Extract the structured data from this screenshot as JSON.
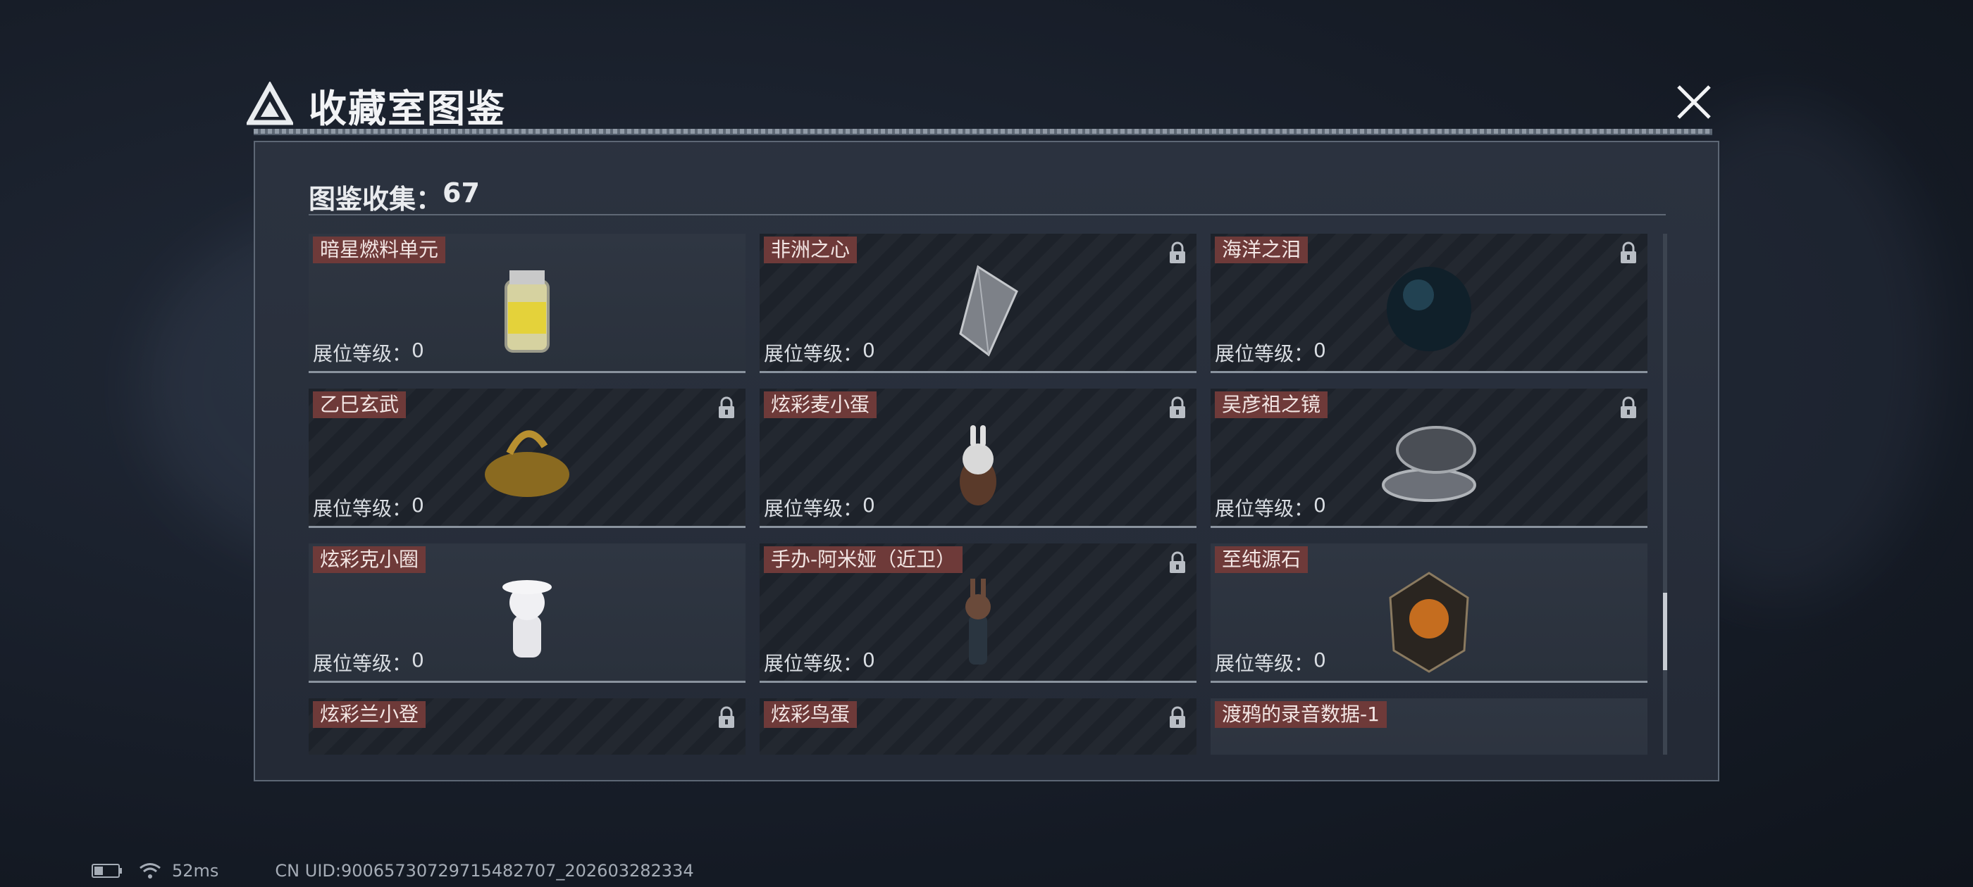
{
  "modal": {
    "title": "收藏室图鉴",
    "collection_label": "图鉴收集：",
    "collection_count": "67"
  },
  "cards": [
    {
      "name": "暗星燃料单元",
      "level_label": "展位等级：",
      "level": "0",
      "locked": false,
      "icon": "fuel-canister-icon"
    },
    {
      "name": "非洲之心",
      "level_label": "展位等级：",
      "level": "0",
      "locked": true,
      "icon": "diamond-icon"
    },
    {
      "name": "海洋之泪",
      "level_label": "展位等级：",
      "level": "0",
      "locked": true,
      "icon": "dark-pearl-icon"
    },
    {
      "name": "乙巳玄武",
      "level_label": "展位等级：",
      "level": "0",
      "locked": true,
      "icon": "golden-turtle-snake-icon"
    },
    {
      "name": "炫彩麦小蛋",
      "level_label": "展位等级：",
      "level": "0",
      "locked": true,
      "icon": "bunny-egg-figure-icon"
    },
    {
      "name": "吴彦祖之镜",
      "level_label": "展位等级：",
      "level": "0",
      "locked": true,
      "icon": "compact-mirror-icon"
    },
    {
      "name": "炫彩克小圈",
      "level_label": "展位等级：",
      "level": "0",
      "locked": false,
      "icon": "cat-figure-icon"
    },
    {
      "name": "手办-阿米娅（近卫）",
      "level_label": "展位等级：",
      "level": "0",
      "locked": true,
      "icon": "amiya-figure-icon"
    },
    {
      "name": "至纯源石",
      "level_label": "展位等级：",
      "level": "0",
      "locked": false,
      "icon": "originium-crystal-icon"
    },
    {
      "name": "炫彩兰小登",
      "level_label": "",
      "level": "",
      "locked": true,
      "icon": "hat-figure-icon"
    },
    {
      "name": "炫彩鸟蛋",
      "level_label": "",
      "level": "",
      "locked": true,
      "icon": "bird-egg-icon"
    },
    {
      "name": "渡鸦的录音数据-1",
      "level_label": "",
      "level": "",
      "locked": false,
      "icon": "recorder-device-icon"
    }
  ],
  "status": {
    "ping": "52ms",
    "uid": "CN UID:9006573072971548​2707_202603282334"
  },
  "colors": {
    "name_tag": "#6e3a39",
    "panel_border": "#5d6775",
    "scrollbar_thumb": "#c7ccd3"
  }
}
